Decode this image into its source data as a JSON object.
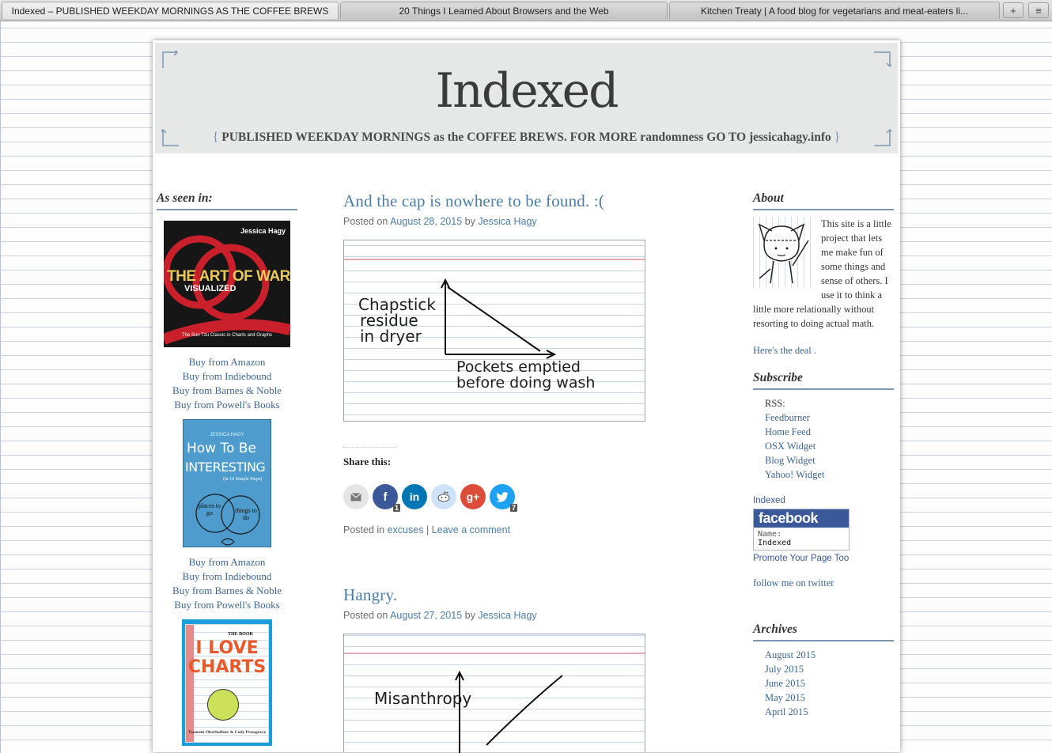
{
  "browser": {
    "tabs": [
      "Indexed – PUBLISHED WEEKDAY MORNINGS AS THE COFFEE BREWS",
      "20 Things I Learned About Browsers and the Web",
      "Kitchen Treaty | A food blog for vegetarians and meat-eaters li..."
    ],
    "new_tab": "+",
    "menu": "≡"
  },
  "site": {
    "logo": "Indexed",
    "tagline": "PUBLISHED WEEKDAY MORNINGS as the COFFEE BREWS. FOR MORE randomness GO TO jessicahagy.info",
    "brace_open": "{",
    "brace_close": "}"
  },
  "left": {
    "title": "As seen in:",
    "books": [
      {
        "cover_lines": [
          "Jessica Hagy",
          "THE ART OF WAR",
          "VISUALIZED",
          "The Sun Tzu Classic in Charts and Graphs"
        ],
        "links": [
          "Buy from Amazon",
          "Buy from Indiebound",
          "Buy from Barnes & Noble",
          "Buy from Powell's Books"
        ]
      },
      {
        "cover_lines": [
          "JESSICA HAGY",
          "How To Be",
          "INTERESTING",
          "(in 10 Simple Steps)",
          "places to go",
          "things to do"
        ],
        "links": [
          "Buy from Amazon",
          "Buy from Indiebound",
          "Buy from Barnes & Noble",
          "Buy from Powell's Books"
        ]
      },
      {
        "cover_lines": [
          "THE BOOK",
          "I LOVE",
          "CHARTS",
          "Tasneem Oberhoffner & Cody Pressgrove"
        ],
        "links": []
      }
    ]
  },
  "posts": [
    {
      "title": "And the cap is nowhere to be found. :(",
      "meta_prefix": "Posted on",
      "date": "August 28, 2015",
      "meta_by": "by",
      "author": "Jessica Hagy",
      "card": {
        "y_label": [
          "Chapstick",
          "residue",
          "in dryer"
        ],
        "x_label": [
          "Pockets emptied",
          "before doing wash"
        ]
      },
      "share_title": "Share this:",
      "share_counts": {
        "facebook": "1",
        "twitter": "7"
      },
      "foot_prefix": "Posted in",
      "category": "excuses",
      "foot_sep": "|",
      "comment": "Leave a comment"
    },
    {
      "title": "Hangry.",
      "meta_prefix": "Posted on",
      "date": "August 27, 2015",
      "meta_by": "by",
      "author": "Jessica Hagy",
      "card": {
        "y_label": [
          "Misanthropy"
        ]
      }
    }
  ],
  "right": {
    "about_title": "About",
    "about_text": "This site is a little project that lets me make fun of some things and sense of others. I use it to think a little more relationally without resorting to doing actual math.",
    "deal_link": "Here's the deal .",
    "subscribe_title": "Subscribe",
    "rss_label": "RSS:",
    "subscribe_links": [
      "Feedburner",
      "Home Feed",
      "OSX Widget",
      "Blog Widget",
      "Yahoo! Widget"
    ],
    "fb_page_link": "Indexed",
    "fb_logo": "facebook",
    "fb_name_label": "Name:",
    "fb_name_value": "Indexed",
    "fb_promote": "Promote Your Page Too",
    "twitter_link": "follow me on twitter",
    "archives_title": "Archives",
    "archives": [
      "August 2015",
      "July 2015",
      "June 2015",
      "May 2015",
      "April 2015"
    ]
  },
  "colors": {
    "link": "#3c6591",
    "post_title": "#4b7da6",
    "header_bg": "#e6e7e7",
    "facebook": "#3b5998",
    "linkedin": "#0077b5",
    "google": "#dd4b39",
    "twitter": "#1da1f2"
  }
}
